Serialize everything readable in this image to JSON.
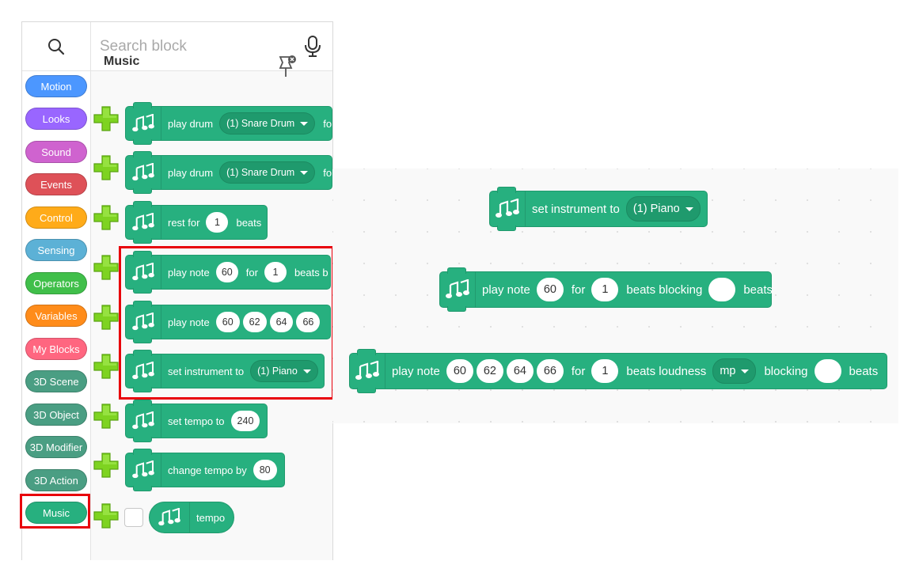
{
  "search": {
    "placeholder": "Search block",
    "search_icon": "search-icon",
    "mic_icon": "microphone-icon"
  },
  "categories": [
    {
      "label": "Motion",
      "color": "#4c97ff"
    },
    {
      "label": "Looks",
      "color": "#9966ff"
    },
    {
      "label": "Sound",
      "color": "#cf63cf"
    },
    {
      "label": "Events",
      "color": "#de5158"
    },
    {
      "label": "Control",
      "color": "#ffab19"
    },
    {
      "label": "Sensing",
      "color": "#5cb1d6"
    },
    {
      "label": "Operators",
      "color": "#40bf4a"
    },
    {
      "label": "Variables",
      "color": "#ff8c1a"
    },
    {
      "label": "My Blocks",
      "color": "#ff6680"
    },
    {
      "label": "3D Scene",
      "color": "#4a9e83"
    },
    {
      "label": "3D Object",
      "color": "#4a9e83"
    },
    {
      "label": "3D Modifier",
      "color": "#4a9e83"
    },
    {
      "label": "3D Action",
      "color": "#4a9e83"
    },
    {
      "label": "Music",
      "color": "#27b07f"
    }
  ],
  "selected_category": "Music",
  "palette": {
    "title": "Music",
    "pin_icon": "pin-close-icon",
    "play_drum_1": {
      "text": "play drum",
      "drum": "(1) Snare Drum",
      "trail": "fo"
    },
    "play_drum_2": {
      "text": "play drum",
      "drum": "(1) Snare Drum",
      "trail": "fo"
    },
    "rest": {
      "text_a": "rest for",
      "beats": "1",
      "text_b": "beats"
    },
    "play_note": {
      "text_a": "play note",
      "note": "60",
      "text_b": "for",
      "beats": "1",
      "text_c": "beats b"
    },
    "play_notes": {
      "text_a": "play note",
      "n1": "60",
      "n2": "62",
      "n3": "64",
      "n4": "66"
    },
    "set_instrument": {
      "text": "set instrument to",
      "instrument": "(1) Piano"
    },
    "set_tempo": {
      "text": "set tempo to",
      "value": "240"
    },
    "change_tempo": {
      "text": "change tempo by",
      "value": "80"
    },
    "tempo_reporter": {
      "text": "tempo"
    }
  },
  "workspace": {
    "set_instrument": {
      "text": "set instrument to",
      "instrument": "(1) Piano"
    },
    "play_note": {
      "text_a": "play note",
      "note": "60",
      "text_b": "for",
      "beats": "1",
      "text_c": "beats blocking",
      "blocking": "",
      "text_d": "beats"
    },
    "play_notes": {
      "text_a": "play note",
      "n1": "60",
      "n2": "62",
      "n3": "64",
      "n4": "66",
      "text_b": "for",
      "beats": "1",
      "text_c": "beats loudness",
      "loudness": "mp",
      "text_d": "blocking",
      "blocking": "",
      "text_e": "beats"
    }
  },
  "colors": {
    "music_block": "#27b07f",
    "music_block_border": "#1f9a6d",
    "highlight": "#e8000b",
    "plus": "#7ed321"
  }
}
